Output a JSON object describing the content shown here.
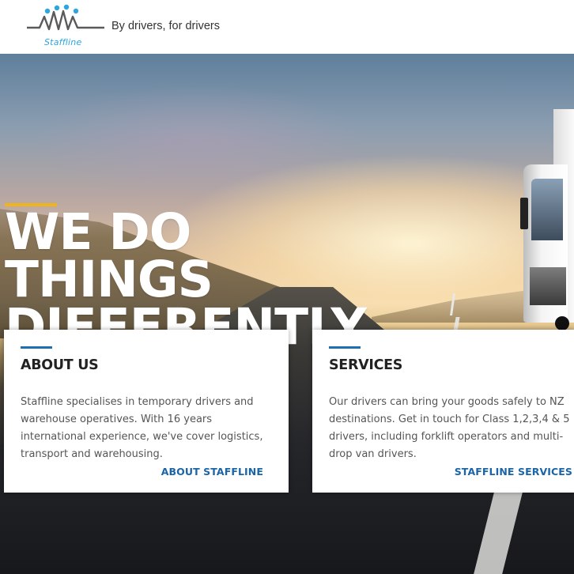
{
  "header": {
    "logo_text": "Staffline",
    "tagline": "By drivers, for drivers"
  },
  "hero": {
    "headline_lines": [
      "WE DO",
      "THINGS",
      "DIFFERENTLY"
    ]
  },
  "cards": [
    {
      "title": "ABOUT US",
      "body": "Staffline specialises in temporary drivers and warehouse operatives. With 16 years international experience, we've cover logistics, transport and warehousing.",
      "link": "ABOUT STAFFLINE"
    },
    {
      "title": "SERVICES",
      "body": "Our drivers can bring your goods safely to NZ destinations. Get in touch for Class 1,2,3,4 & 5 drivers, including forklift operators and multi-drop van drivers.",
      "link": "STAFFLINE SERVICES"
    }
  ],
  "colors": {
    "accent_yellow": "#f0b51c",
    "accent_blue": "#1e6fb0",
    "link_blue": "#1a64a8",
    "logo_blue": "#2aa6e0"
  }
}
